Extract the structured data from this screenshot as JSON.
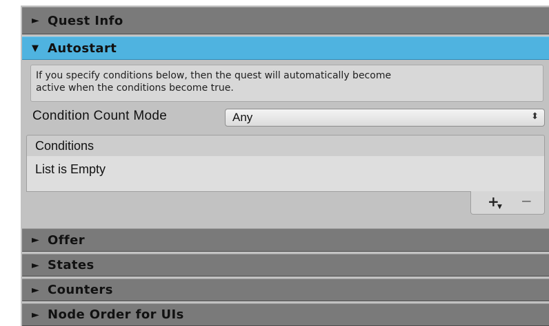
{
  "sections": {
    "quest_info": {
      "label": "Quest Info",
      "expanded": false
    },
    "autostart": {
      "label": "Autostart",
      "expanded": true
    },
    "offer": {
      "label": "Offer",
      "expanded": false
    },
    "states": {
      "label": "States",
      "expanded": false
    },
    "counters": {
      "label": "Counters",
      "expanded": false
    },
    "node_order": {
      "label": "Node Order for UIs",
      "expanded": false
    }
  },
  "arrows": {
    "collapsed": "►",
    "expanded": "▼"
  },
  "autostart": {
    "help_line1": "If you specify conditions below, then the quest will automatically become",
    "help_line2": "active when the conditions become true.",
    "condition_count_mode_label": "Condition Count Mode",
    "condition_count_mode_value": "Any",
    "conditions_header": "Conditions",
    "conditions_empty": "List is Empty",
    "add_label": "+",
    "remove_label": "−"
  },
  "colors": {
    "active_header": "#4fb3e0",
    "collapsed_header": "#7a7a7a",
    "panel_bg": "#c2c2c2"
  }
}
